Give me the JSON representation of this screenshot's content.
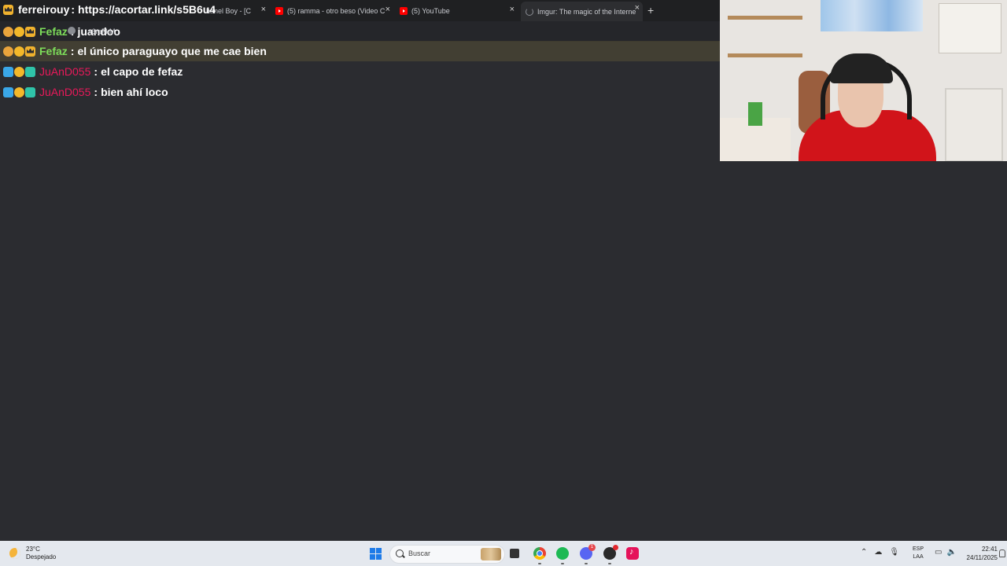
{
  "browser": {
    "tabs": [
      {
        "label": "hanel Boy - [C",
        "icon": "generic-tab-icon"
      },
      {
        "label": "(5) ramma - otro beso (Video C",
        "icon": "youtube-icon"
      },
      {
        "label": "(5) YouTube",
        "icon": "youtube-icon"
      },
      {
        "label": "Imgur: The magic of the Interne",
        "icon": "loading-spinner-icon",
        "active": true
      }
    ],
    "close_glyph": "×",
    "new_tab_glyph": "+",
    "url_partial": "x6rsFkM"
  },
  "overlay": {
    "user": "ferreirouy",
    "separator": ":",
    "text": "https://acortar.link/s5B6u4"
  },
  "chat": {
    "messages": [
      {
        "user": "Fefaz",
        "sep": ":",
        "text": "juandoo",
        "user_color": "#7ddc5a"
      },
      {
        "user": "Fefaz",
        "sep": ":",
        "text": "el único paraguayo que me cae bien",
        "user_color": "#7ddc5a"
      },
      {
        "user": "JuAnD055",
        "sep": ":",
        "text": "el capo de fefaz",
        "user_color": "#e8195a"
      },
      {
        "user": "JuAnD055",
        "sep": ":",
        "text": "bien ahí loco",
        "user_color": "#e8195a"
      }
    ]
  },
  "taskbar": {
    "weather_temp": "23°C",
    "weather_desc": "Despejado",
    "search_label": "Buscar",
    "discord_badge": "1",
    "lang_line1": "ESP",
    "lang_line2": "LAA",
    "time": "22:41",
    "date": "24/11/2025"
  },
  "colors": {
    "background": "#2b2c30",
    "highlight_row": "#5b5639",
    "accent_windows": "#1e7be8"
  }
}
